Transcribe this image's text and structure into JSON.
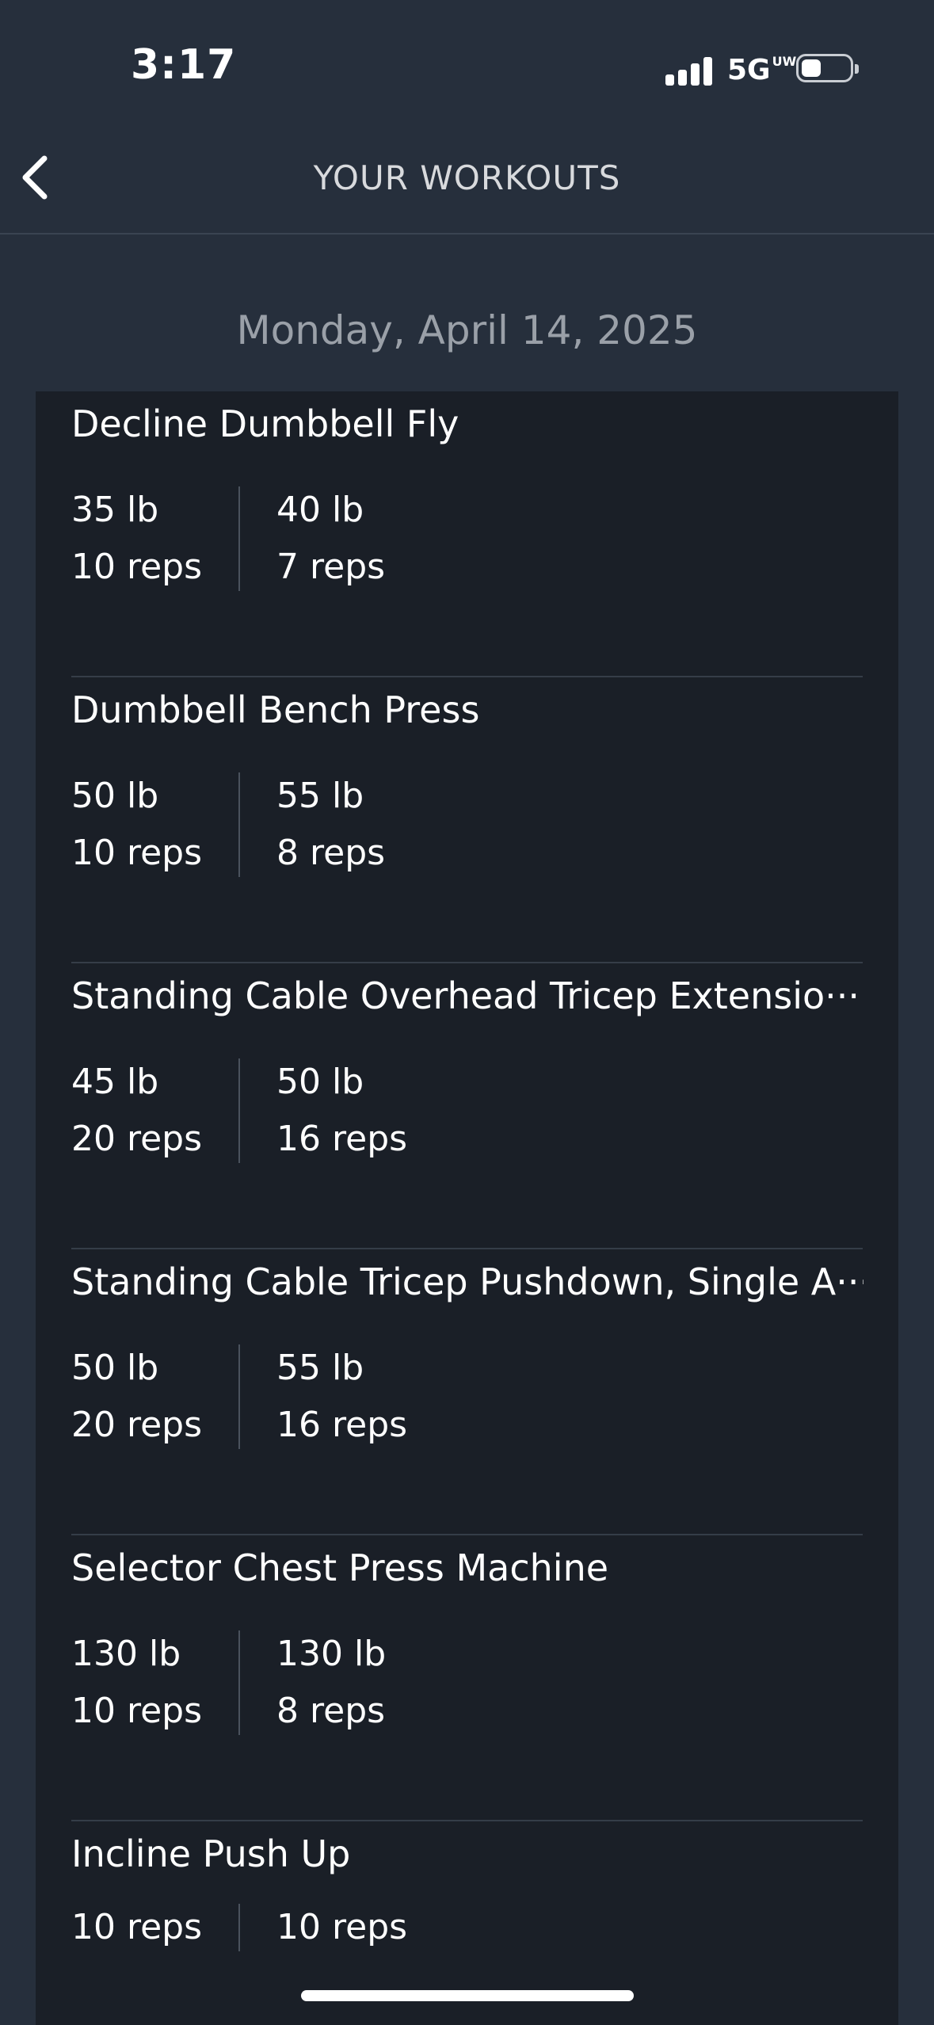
{
  "status": {
    "time": "3:17",
    "network": "5G",
    "network_sup": "UW"
  },
  "nav": {
    "title": "YOUR WORKOUTS"
  },
  "date": "Monday, April 14, 2025",
  "exercises": [
    {
      "name": "Decline Dumbbell Fly",
      "sets": [
        {
          "weight": "35 lb",
          "reps": "10 reps"
        },
        {
          "weight": "40 lb",
          "reps": "7 reps"
        }
      ]
    },
    {
      "name": "Dumbbell Bench Press",
      "sets": [
        {
          "weight": "50 lb",
          "reps": "10 reps"
        },
        {
          "weight": "55 lb",
          "reps": "8 reps"
        }
      ]
    },
    {
      "name": "Standing Cable Overhead Tricep Extensio···",
      "sets": [
        {
          "weight": "45 lb",
          "reps": "20 reps"
        },
        {
          "weight": "50 lb",
          "reps": "16 reps"
        }
      ]
    },
    {
      "name": "Standing Cable Tricep Pushdown, Single A···",
      "sets": [
        {
          "weight": "50 lb",
          "reps": "20 reps"
        },
        {
          "weight": "55 lb",
          "reps": "16 reps"
        }
      ]
    },
    {
      "name": "Selector Chest Press Machine",
      "sets": [
        {
          "weight": "130 lb",
          "reps": "10 reps"
        },
        {
          "weight": "130 lb",
          "reps": "8 reps"
        }
      ]
    },
    {
      "name": "Incline Push Up",
      "sets": [
        {
          "reps": "10 reps"
        },
        {
          "reps": "10 reps"
        }
      ]
    }
  ]
}
